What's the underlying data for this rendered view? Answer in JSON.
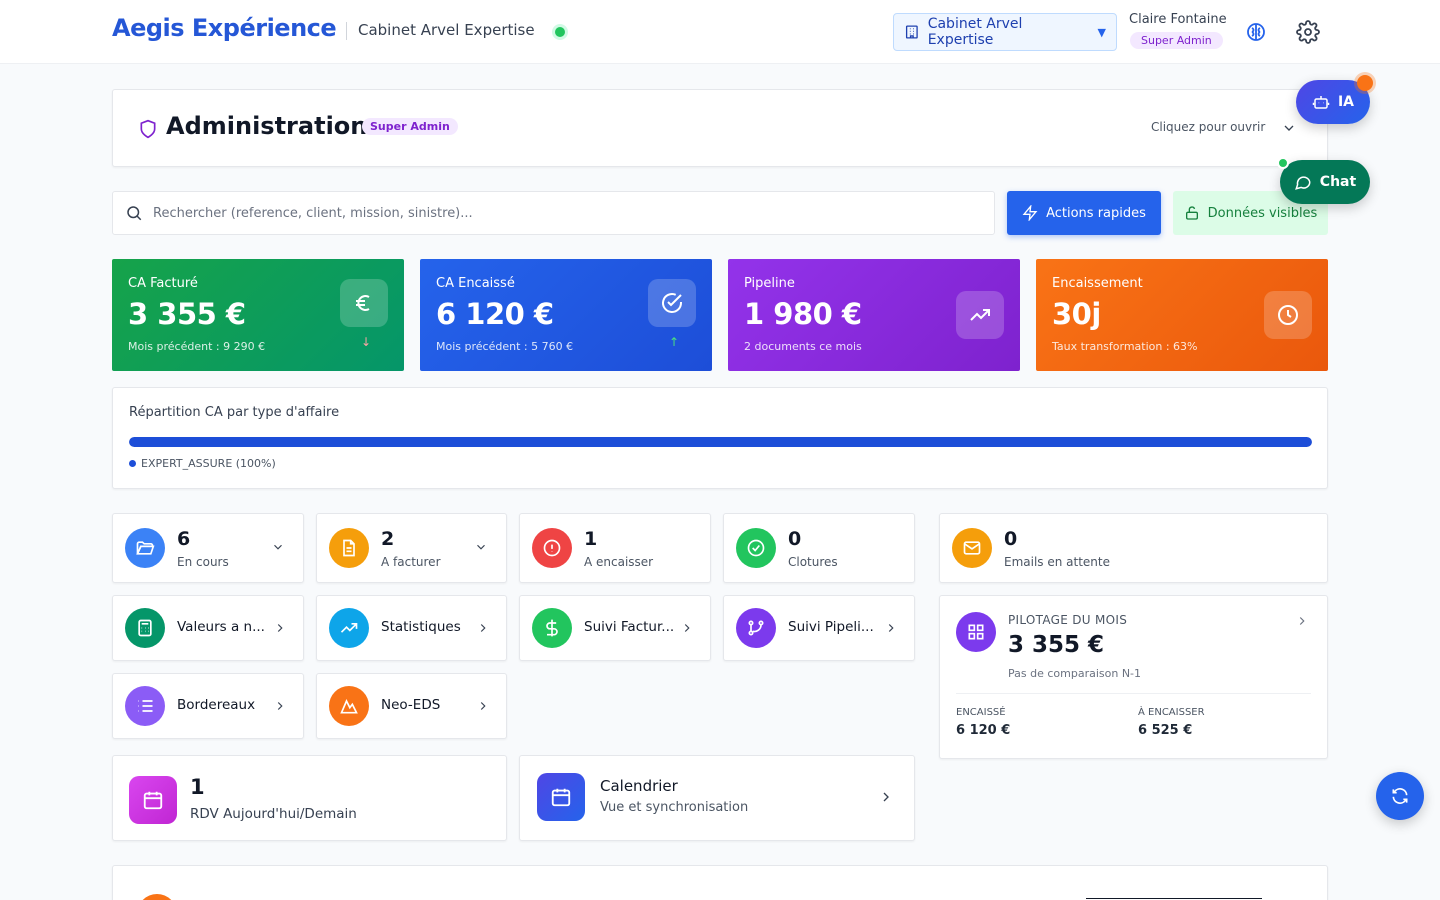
{
  "header": {
    "brand": "Aegis Expérience",
    "cabinet": "Cabinet Arvel Expertise",
    "selector_label": "Cabinet Arvel Expertise",
    "selector_chevron": "▼",
    "user_name": "Claire Fontaine",
    "user_role": "Super Admin"
  },
  "admin": {
    "title": "Administration",
    "badge": "Super Admin",
    "hint": "Cliquez pour ouvrir"
  },
  "search": {
    "placeholder": "Rechercher (reference, client, mission, sinistre)..."
  },
  "actions": {
    "quick": "Actions rapides",
    "visible_data": "Données visibles"
  },
  "kpis": [
    {
      "label": "CA Facturé",
      "value": "3 355 €",
      "sub": "Mois précédent : 9 290 €",
      "trend": "↓",
      "color_from": "#16a34a",
      "color_to": "#059669",
      "icon": "euro-icon"
    },
    {
      "label": "CA Encaissé",
      "value": "6 120 €",
      "sub": "Mois précédent : 5 760 €",
      "trend": "↑",
      "color_from": "#2563eb",
      "color_to": "#1d4ed8",
      "icon": "check-circle-icon"
    },
    {
      "label": "Pipeline",
      "value": "1 980 €",
      "sub": "2 documents ce mois",
      "color_from": "#9333ea",
      "color_to": "#7e22ce",
      "icon": "trending-up-icon"
    },
    {
      "label": "Encaissement",
      "value": "30j",
      "sub": "Taux transformation : 63%",
      "color_from": "#f97316",
      "color_to": "#ea580c",
      "icon": "clock-icon"
    }
  ],
  "repartition": {
    "title": "Répartition CA par type d'affaire",
    "share": 1.0,
    "legend": "EXPERT_ASSURE (100%)"
  },
  "stats": [
    {
      "count": "6",
      "label": "En cours",
      "color": "#2563eb"
    },
    {
      "count": "2",
      "label": "A facturer",
      "color": "#f59e0b"
    },
    {
      "count": "1",
      "label": "A encaisser",
      "color": "#ef4444"
    },
    {
      "count": "0",
      "label": "Clotures",
      "color": "#22c55e"
    },
    {
      "count": "0",
      "label": "Emails en attente",
      "color": "#f59e0b"
    }
  ],
  "nav": [
    {
      "label": "Valeurs a n...",
      "color": "#059669"
    },
    {
      "label": "Statistiques",
      "color": "#0ea5e9"
    },
    {
      "label": "Suivi Factur...",
      "color": "#22c55e"
    },
    {
      "label": "Suivi Pipeli...",
      "color": "#7c3aed"
    },
    {
      "label": "Bordereaux",
      "color": "#8b5cf6"
    },
    {
      "label": "Neo-EDS",
      "color": "#f97316"
    }
  ],
  "pilotage": {
    "title": "PILOTAGE DU MOIS",
    "value": "3 355 €",
    "sub": "Pas de comparaison N-1",
    "encaisse_label": "ENCAISSÉ",
    "encaisse_value": "6 120 €",
    "a_encaisser_label": "À ENCAISSER",
    "a_encaisser_value": "6 525 €"
  },
  "rdv": {
    "count": "1",
    "label": "RDV Aujourd'hui/Demain"
  },
  "calendar": {
    "title": "Calendrier",
    "sub": "Vue et synchronisation"
  },
  "fab": {
    "ia": "IA",
    "chat": "Chat"
  }
}
